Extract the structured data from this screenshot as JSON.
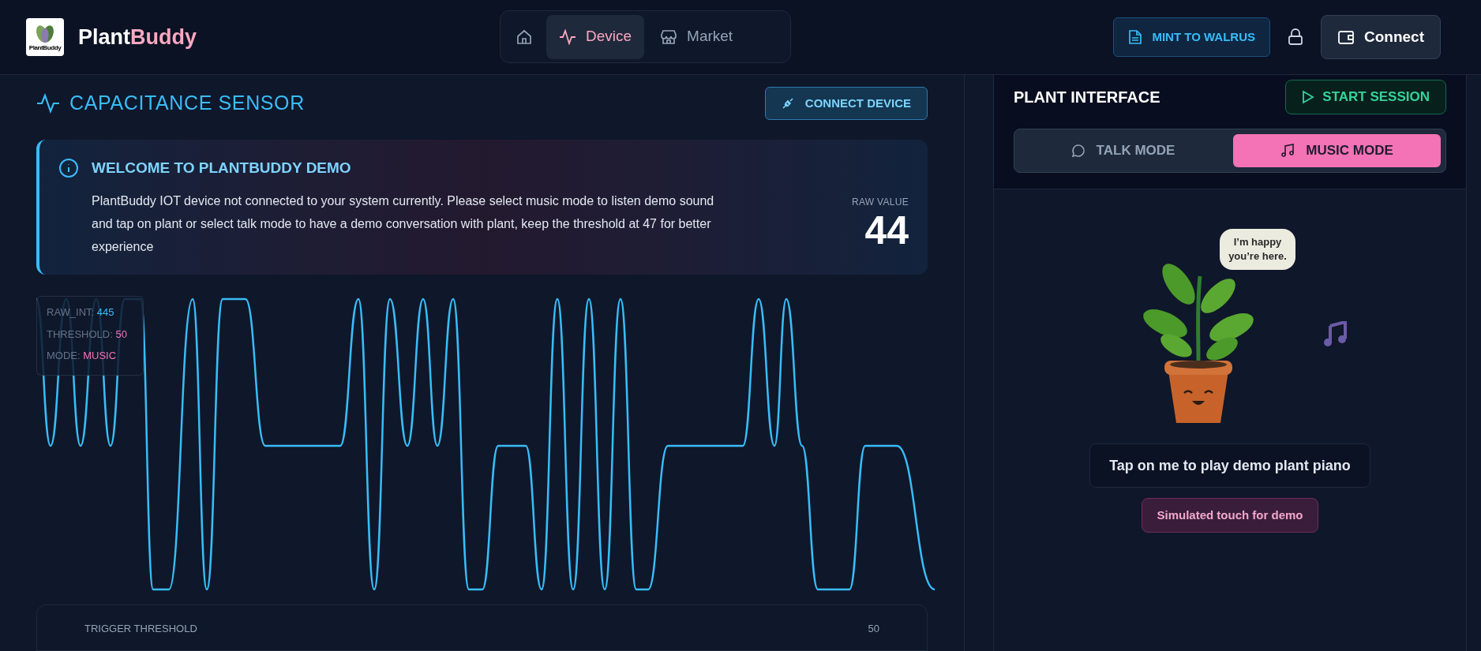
{
  "header": {
    "logo_caption": "PlantBuddy",
    "brand_first": "Plant",
    "brand_second": "Buddy",
    "nav": [
      {
        "kind": "home",
        "selected": false
      },
      {
        "kind": "device",
        "label": "Device",
        "selected": true
      },
      {
        "kind": "market",
        "label": "Market",
        "selected": false
      }
    ],
    "mint_button": "MINT TO WALRUS",
    "connect_button": "Connect"
  },
  "sensor": {
    "title": "CAPACITANCE SENSOR",
    "connect_button": "CONNECT DEVICE",
    "banner": {
      "title": "WELCOME TO PLANTBUDDY DEMO",
      "body": "PlantBuddy IOT device not connected to your system currently. Please select music mode to listen demo sound and tap on plant or select talk mode to have a demo conversation with plant, keep the threshold at 47 for better experience",
      "raw_label": "RAW VALUE",
      "raw_value": "44"
    },
    "stats": [
      {
        "label": "RAW_INT:",
        "value": "445",
        "color": "#38bdf8"
      },
      {
        "label": "THRESHOLD:",
        "value": "50",
        "color": "#f472b6"
      },
      {
        "label": "MODE:",
        "value": "MUSIC",
        "color": "#f472b6"
      }
    ],
    "threshold": {
      "label": "TRIGGER THRESHOLD",
      "value": "50"
    }
  },
  "plant": {
    "title": "PLANT INTERFACE",
    "start_button": "START SESSION",
    "modes": [
      {
        "kind": "talk",
        "label": "TALK MODE",
        "selected": false
      },
      {
        "kind": "music",
        "label": "MUSIC MODE",
        "selected": true
      }
    ],
    "bubble": "I’m happy you’re here.",
    "hint": "Tap on me to play demo plant piano",
    "tag": "Simulated touch for demo"
  }
}
